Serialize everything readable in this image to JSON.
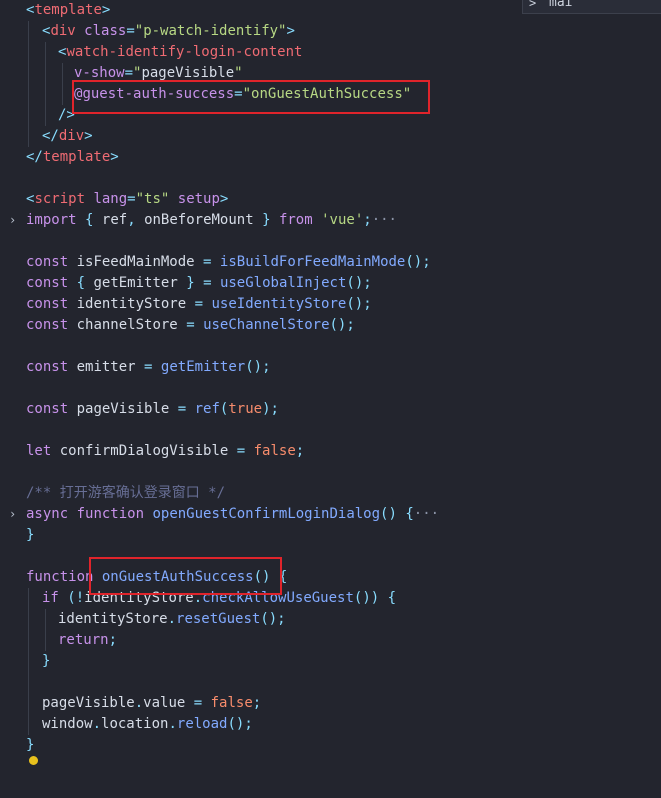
{
  "find_widget": {
    "chevron": ">",
    "text": "mai"
  },
  "code": {
    "l1": {
      "a": "<",
      "b": "template",
      "c": ">"
    },
    "l2": {
      "a": "<",
      "b": "div",
      "c": "class",
      "d": "=",
      "e": "\"p-watch-identify\"",
      "f": ">"
    },
    "l3": {
      "a": "<",
      "b": "watch-identify-login-content"
    },
    "l4": {
      "a": "v-show",
      "b": "=",
      "c": "\"",
      "d": "pageVisible",
      "e": "\""
    },
    "l5": {
      "a": "@",
      "b": "guest-auth-success",
      "c": "=",
      "d": "\"",
      "e": "onGuestAuthSuccess",
      "f": "\""
    },
    "l6": {
      "a": "/>"
    },
    "l7": {
      "a": "</",
      "b": "div",
      "c": ">"
    },
    "l8": {
      "a": "</",
      "b": "template",
      "c": ">"
    },
    "l10": {
      "a": "<",
      "b": "script",
      "c": "lang",
      "d": "=",
      "e": "\"ts\"",
      "f": "setup",
      "g": ">"
    },
    "l11": {
      "a": "import",
      "b": "{",
      "c": "ref",
      "d": ",",
      "e": "onBeforeMount",
      "f": "}",
      "g": "from",
      "h": "'vue'",
      "i": ";",
      "dots": "···"
    },
    "l13": {
      "a": "const",
      "b": "isFeedMainMode",
      "c": "=",
      "d": "isBuildForFeedMainMode",
      "e": "();"
    },
    "l14": {
      "a": "const",
      "b": "{",
      "c": "getEmitter",
      "d": "}",
      "e": "=",
      "f": "useGlobalInject",
      "g": "();"
    },
    "l15": {
      "a": "const",
      "b": "identityStore",
      "c": "=",
      "d": "useIdentityStore",
      "e": "();"
    },
    "l16": {
      "a": "const",
      "b": "channelStore",
      "c": "=",
      "d": "useChannelStore",
      "e": "();"
    },
    "l18": {
      "a": "const",
      "b": "emitter",
      "c": "=",
      "d": "getEmitter",
      "e": "();"
    },
    "l20": {
      "a": "const",
      "b": "pageVisible",
      "c": "=",
      "d": "ref",
      "e": "(",
      "f": "true",
      "g": ");"
    },
    "l22": {
      "a": "let",
      "b": "confirmDialogVisible",
      "c": "=",
      "d": "false",
      "e": ";"
    },
    "l24": {
      "a": "/** 打开游客确认登录窗口 */"
    },
    "l25": {
      "a": "async",
      "b": "function",
      "c": "openGuestConfirmLoginDialog",
      "d": "() {",
      "dots": "···"
    },
    "l26": {
      "a": "}"
    },
    "l28": {
      "a": "function",
      "b": "onGuestAuthSuccess",
      "c": "() {"
    },
    "l29": {
      "a": "if",
      "b": "(!",
      "c": "identityStore",
      "d": ".",
      "e": "checkAllowUseGuest",
      "f": "()) {"
    },
    "l30": {
      "a": "identityStore",
      "b": ".",
      "c": "resetGuest",
      "d": "();"
    },
    "l31": {
      "a": "return",
      "b": ";"
    },
    "l32": {
      "a": "}"
    },
    "l34": {
      "a": "pageVisible",
      "b": ".",
      "c": "value",
      "d": "=",
      "e": "false",
      "f": ";"
    },
    "l35": {
      "a": "window",
      "b": ".",
      "c": "location",
      "d": ".",
      "e": "reload",
      "f": "();"
    },
    "l36": {
      "a": "}"
    }
  },
  "folds": [
    "›",
    "›"
  ],
  "colors": {
    "background": "#23252e",
    "highlight_box": "#e0242b",
    "tag": "#ef6b73",
    "keyword": "#c792ea",
    "string": "#b7d884",
    "function": "#82aaff"
  }
}
